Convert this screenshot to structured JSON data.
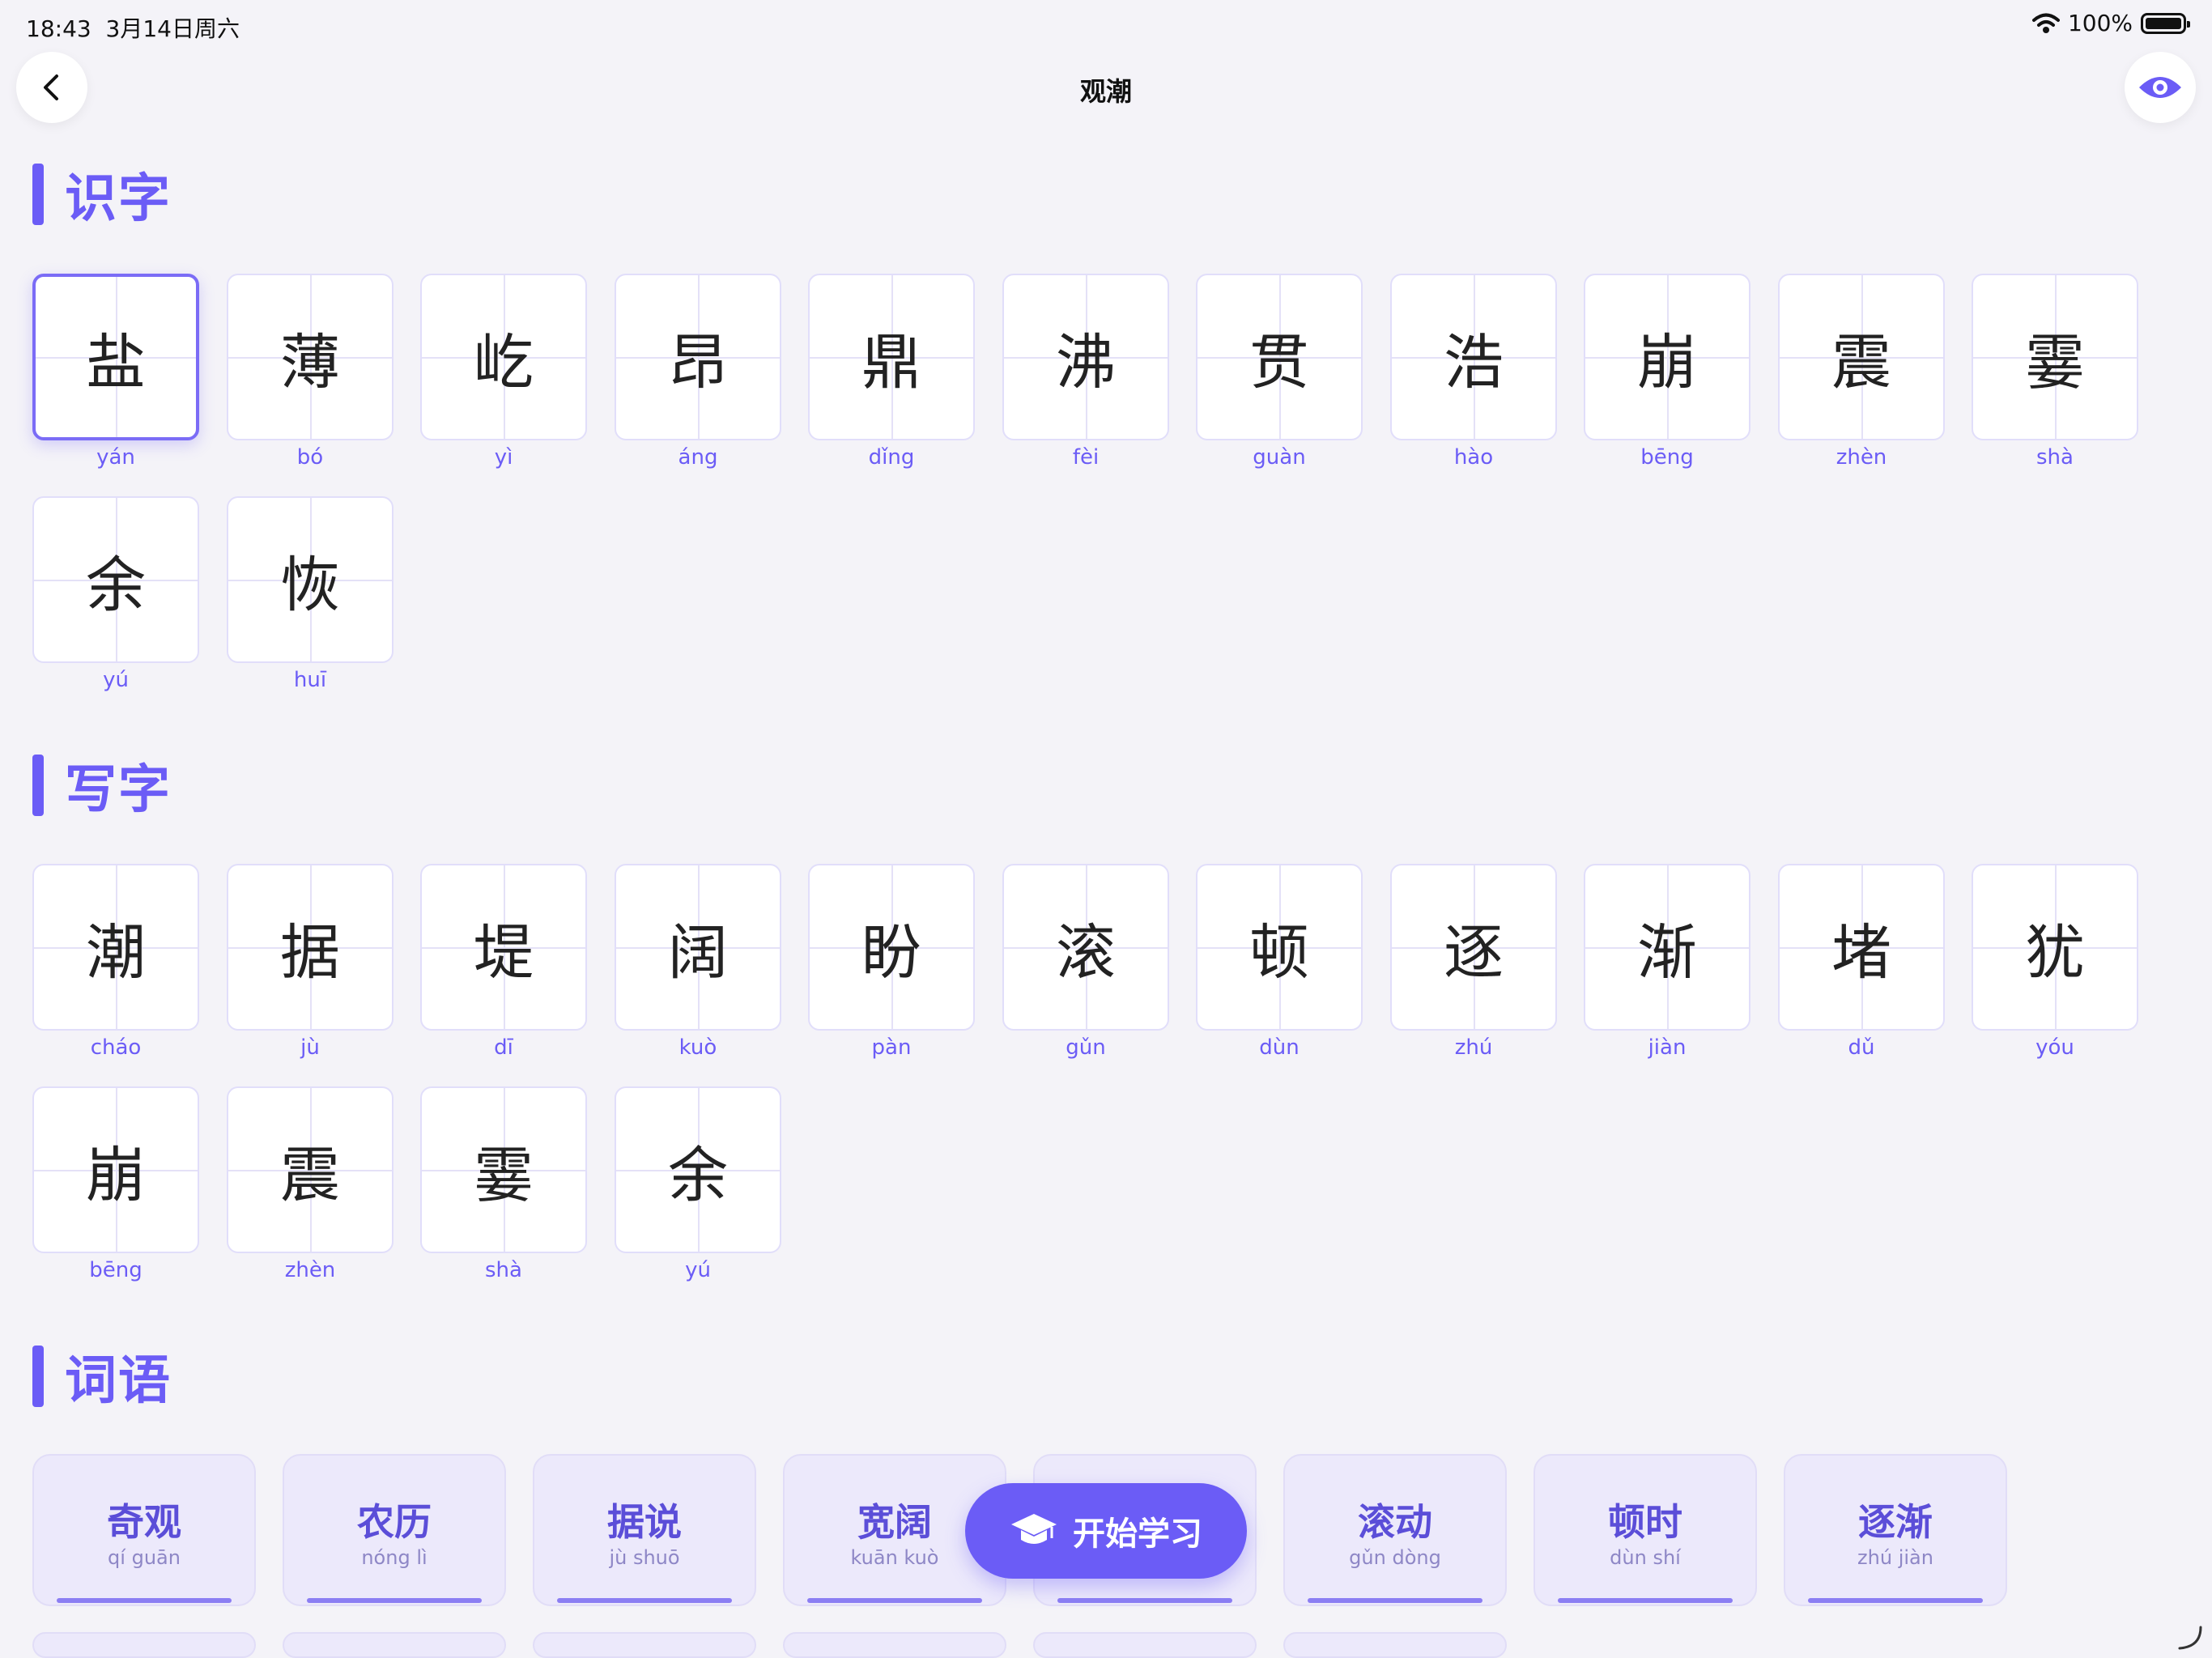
{
  "status": {
    "time": "18:43",
    "date": "3月14日周六",
    "battery": "100%"
  },
  "nav": {
    "title": "观潮"
  },
  "sections": {
    "shizi": {
      "title": "识字"
    },
    "xiezi": {
      "title": "写字"
    },
    "ciyu": {
      "title": "词语"
    }
  },
  "shizi_chars": [
    {
      "char": "盐",
      "pinyin": "yán"
    },
    {
      "char": "薄",
      "pinyin": "bó"
    },
    {
      "char": "屹",
      "pinyin": "yì"
    },
    {
      "char": "昂",
      "pinyin": "áng"
    },
    {
      "char": "鼎",
      "pinyin": "dǐng"
    },
    {
      "char": "沸",
      "pinyin": "fèi"
    },
    {
      "char": "贯",
      "pinyin": "guàn"
    },
    {
      "char": "浩",
      "pinyin": "hào"
    },
    {
      "char": "崩",
      "pinyin": "bēng"
    },
    {
      "char": "震",
      "pinyin": "zhèn"
    },
    {
      "char": "霎",
      "pinyin": "shà"
    },
    {
      "char": "余",
      "pinyin": "yú"
    },
    {
      "char": "恢",
      "pinyin": "huī"
    }
  ],
  "xiezi_chars": [
    {
      "char": "潮",
      "pinyin": "cháo"
    },
    {
      "char": "据",
      "pinyin": "jù"
    },
    {
      "char": "堤",
      "pinyin": "dī"
    },
    {
      "char": "阔",
      "pinyin": "kuò"
    },
    {
      "char": "盼",
      "pinyin": "pàn"
    },
    {
      "char": "滚",
      "pinyin": "gǔn"
    },
    {
      "char": "顿",
      "pinyin": "dùn"
    },
    {
      "char": "逐",
      "pinyin": "zhú"
    },
    {
      "char": "渐",
      "pinyin": "jiàn"
    },
    {
      "char": "堵",
      "pinyin": "dǔ"
    },
    {
      "char": "犹",
      "pinyin": "yóu"
    },
    {
      "char": "崩",
      "pinyin": "bēng"
    },
    {
      "char": "震",
      "pinyin": "zhèn"
    },
    {
      "char": "霎",
      "pinyin": "shà"
    },
    {
      "char": "余",
      "pinyin": "yú"
    }
  ],
  "words": [
    {
      "word": "奇观",
      "pinyin": "qí guān"
    },
    {
      "word": "农历",
      "pinyin": "nóng lì"
    },
    {
      "word": "据说",
      "pinyin": "jù shuō"
    },
    {
      "word": "宽阔",
      "pinyin": "kuān kuò"
    },
    {
      "word": "",
      "pinyin": ""
    },
    {
      "word": "滚动",
      "pinyin": "gǔn dòng"
    },
    {
      "word": "顿时",
      "pinyin": "dùn shí"
    },
    {
      "word": "逐渐",
      "pinyin": "zhú jiàn"
    }
  ],
  "start_button": {
    "label": "开始学习",
    "icon": "graduation-cap-icon"
  },
  "colors": {
    "accent": "#6b5cf6",
    "background": "#f4f3f8",
    "word_card_bg": "#ece9fb"
  },
  "selected_char_index": 0
}
